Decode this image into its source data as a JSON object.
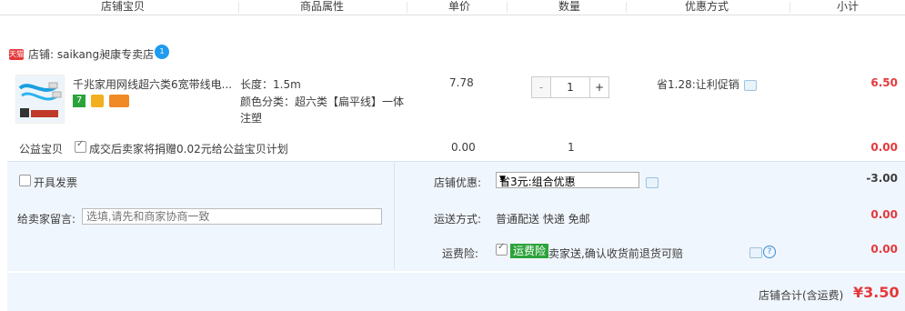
{
  "header": {
    "col_item": "店铺宝贝",
    "col_attr": "商品属性",
    "col_price": "单价",
    "col_qty": "数量",
    "col_promo": "优惠方式",
    "col_subtotal": "小计"
  },
  "shop": {
    "badge": "天猫",
    "label": "店铺: saikang昶康专卖店",
    "ww_icon": "1"
  },
  "item": {
    "title": "千兆家用网线超六类6宽带线电...",
    "length": "长度：1.5m",
    "color_label": "颜色分类：超六类【扁平线】一体",
    "color_cont": "注塑",
    "price": "7.78",
    "qty": "1",
    "qty_minus": "-",
    "qty_plus": "+",
    "discount": "省1.28:让利促销",
    "subtotal": "6.50",
    "service_icon_1": "7"
  },
  "charity": {
    "label": "公益宝贝",
    "text": "成交后卖家将捐赠0.02元给公益宝贝计划",
    "price": "0.00",
    "qty": "1",
    "subtotal": "0.00"
  },
  "options": {
    "invoice": "开具发票",
    "message_label": "给卖家留言:",
    "message_placeholder": "选填,请先和商家协商一致",
    "shop_promo_label": "店铺优惠:",
    "shop_promo_value": "省3元:组合优惠",
    "shop_promo_amount": "-3.00",
    "delivery_label": "运送方式:",
    "delivery_value": "普通配送 快递 免邮",
    "delivery_amount": "0.00",
    "insurance_label": "运费险:",
    "insurance_tag": "运费险",
    "insurance_text": "卖家送,确认收货前退货可赔",
    "insurance_amount": "0.00"
  },
  "total": {
    "label": "店铺合计(含运费)",
    "amount": "¥3.50"
  },
  "colors": {
    "accent_red": "#e4393c",
    "panel_bg": "#f0f6fd",
    "insure_green": "#2ca33a"
  }
}
